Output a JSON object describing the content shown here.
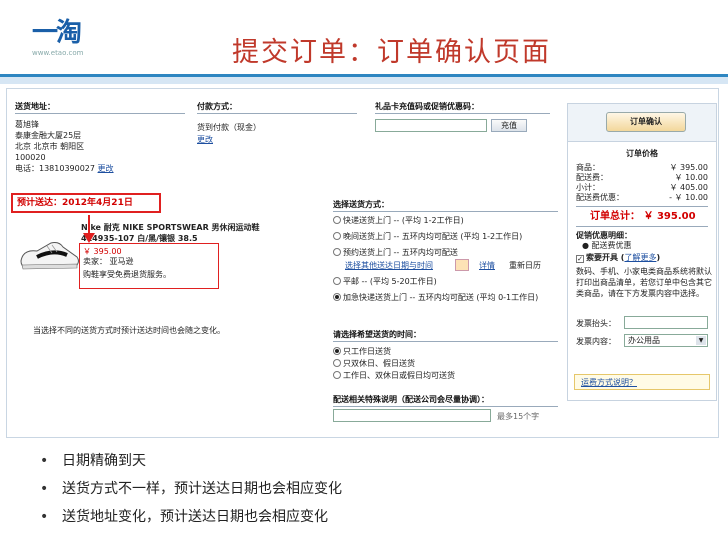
{
  "logo": {
    "mark": "一淘",
    "url": "www.etao.com"
  },
  "slide_title": "提交订单：订单确认页面",
  "address": {
    "header": "送货地址：",
    "name": "葛旭锋",
    "building": "泰康金融大厦25层",
    "city": "北京 北京市 朝阳区",
    "zip": "100020",
    "phone": "电话：13810390027",
    "change": "更改"
  },
  "payment": {
    "header": "付款方式：",
    "method": "货到付款（现金）",
    "change": "更改"
  },
  "gift": {
    "header": "礼品卡充值码或促销优惠码：",
    "apply_button": "充值"
  },
  "estimate": "预计送达：2012年4月21日",
  "product": {
    "name_line1": "Nike 耐克 NIKE SPORTSWEAR 男休闲运动鞋",
    "name_line2": "414935-107 白/黑/镶银 38.5",
    "price": "￥ 395.00",
    "seller": "卖家： 亚马逊",
    "promo": "购鞋享受免费退货服务。"
  },
  "shipping": {
    "header": "选择送货方式：",
    "options": [
      "快递送货上门 -- (平均 1-2工作日)",
      "晚间送货上门 -- 五环内均可配送 (平均 1-2工作日)",
      "预约送货上门 -- 五环内均可配送",
      "平邮 -- (平均 5-20工作日)",
      "加急快递送货上门 -- 五环内均可配送 (平均 0-1工作日)"
    ],
    "calendar_link": "选择其他送达日期与时间",
    "detail_link": "详情",
    "reset": "重新日历"
  },
  "note": "当选择不同的送货方式时预计送达时间也会随之变化。",
  "time": {
    "header": "请选择希望送货的时间：",
    "options": [
      "只工作日送货",
      "只双休日、假日送货",
      "工作日、双休日或假日均可送货"
    ]
  },
  "special": {
    "header": "配送相关特殊说明（配送公司会尽量协调）：",
    "counter": "最多15个字"
  },
  "summary": {
    "confirm_button": "订单确认",
    "price_header": "订单价格",
    "lines": [
      {
        "label": "商品：",
        "value": "￥ 395.00"
      },
      {
        "label": "配送费：",
        "value": "￥ 10.00"
      },
      {
        "label": "小计：",
        "value": "￥ 405.00"
      },
      {
        "label": "配送费优惠：",
        "value": "- ￥ 10.00"
      }
    ],
    "total": "订单总计： ￥ 395.00",
    "promo_header": "促销优惠明细：",
    "promo_item": "● 配送费优惠",
    "invoice_check": "索要开具",
    "invoice_link": "了解更多",
    "invoice_note": "数码、手机、小家电类商品系统将默认打印出商品清单，若您订单中包含其它类商品，请在下方发票内容中选择。",
    "invoice_title_label": "发票抬头：",
    "invoice_content_label": "发票内容：",
    "invoice_content_value": "办公用品",
    "tip_link": "运费方式说明？"
  },
  "bullets": [
    "日期精确到天",
    "送货方式不一样，预计送达日期也会相应变化",
    "送货地址变化，预计送达日期也会相应变化"
  ]
}
